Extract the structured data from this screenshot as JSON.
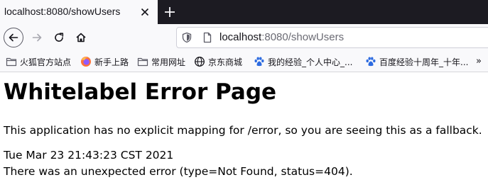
{
  "tab": {
    "title": "localhost:8080/showUsers"
  },
  "nav": {
    "url_host": "localhost",
    "url_rest": ":8080/showUsers"
  },
  "bookmarks": [
    {
      "label": "火狐官方站点",
      "icon": "folder-icon"
    },
    {
      "label": "新手上路",
      "icon": "firefox-icon"
    },
    {
      "label": "常用网址",
      "icon": "folder-icon"
    },
    {
      "label": "京东商城",
      "icon": "globe-icon"
    },
    {
      "label": "我的经验_个人中心_...",
      "icon": "baidu-paw-icon"
    },
    {
      "label": "百度经验十周年_十年...",
      "icon": "baidu-paw-icon"
    }
  ],
  "bookmarks_overflow": "»",
  "page": {
    "heading": "Whitelabel Error Page",
    "explanation": "This application has no explicit mapping for /error, so you are seeing this as a fallback.",
    "timestamp": "Tue Mar 23 21:43:23 CST 2021",
    "error": "There was an unexpected error (type=Not Found, status=404)."
  },
  "colors": {
    "tabstrip": "#1c1b22",
    "toolbar": "#f9f9fb",
    "baidu_blue": "#2d6be0",
    "firefox_orange": "#ff7139"
  }
}
